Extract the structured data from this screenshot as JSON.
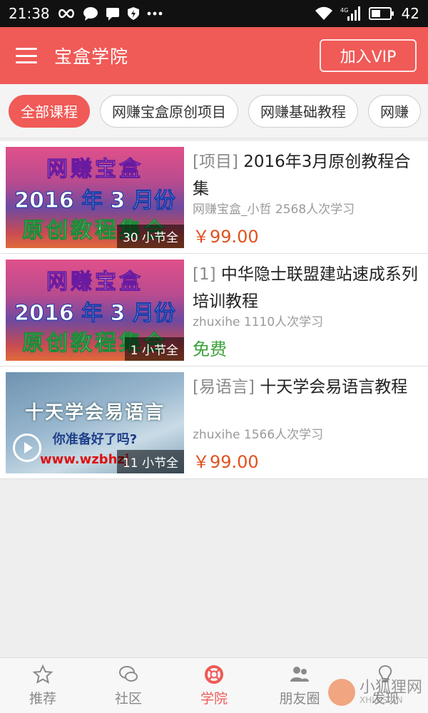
{
  "statusbar": {
    "time": "21:38",
    "battery": "42",
    "network": "4G"
  },
  "header": {
    "title": "宝盒学院",
    "vip_label": "加入VIP"
  },
  "categories": [
    {
      "label": "全部课程",
      "active": true
    },
    {
      "label": "网赚宝盒原创项目"
    },
    {
      "label": "网赚基础教程"
    },
    {
      "label": "网赚"
    }
  ],
  "courses": [
    {
      "thumb_lines": [
        "网赚宝盒",
        "2016 年 3 月份",
        "原创教程集合"
      ],
      "badge": "30 小节全",
      "tag": "[项目]",
      "title": "2016年3月原创教程合集",
      "meta": "网赚宝盒_小哲 2568人次学习",
      "price": "￥99.00"
    },
    {
      "thumb_lines": [
        "网赚宝盒",
        "2016 年 3 月份",
        "原创教程集合"
      ],
      "badge": "1 小节全",
      "tag": "[1]",
      "title": "中华隐士联盟建站速成系列培训教程",
      "meta": "zhuxihe 1110人次学习",
      "price": "免费"
    },
    {
      "thumb_lines": [
        "十天学会易语言",
        "你准备好了吗?",
        "www.wzbhzj"
      ],
      "badge": "11 小节全",
      "tag": "[易语言]",
      "title": "十天学会易语言教程",
      "meta": "zhuxihe 1566人次学习",
      "price": "￥99.00"
    }
  ],
  "bottom_nav": [
    {
      "label": "推荐",
      "icon": "star-icon"
    },
    {
      "label": "社区",
      "icon": "chat-icon"
    },
    {
      "label": "学院",
      "icon": "lifebuoy-icon",
      "active": true
    },
    {
      "label": "朋友圈",
      "icon": "people-icon"
    },
    {
      "label": "发现",
      "icon": "bulb-icon"
    }
  ],
  "watermark": {
    "text": "小狐狸网",
    "sub": "XHLKS.CN"
  },
  "colors": {
    "accent": "#f05a57",
    "price": "#e0521e",
    "free": "#3aa33a"
  }
}
